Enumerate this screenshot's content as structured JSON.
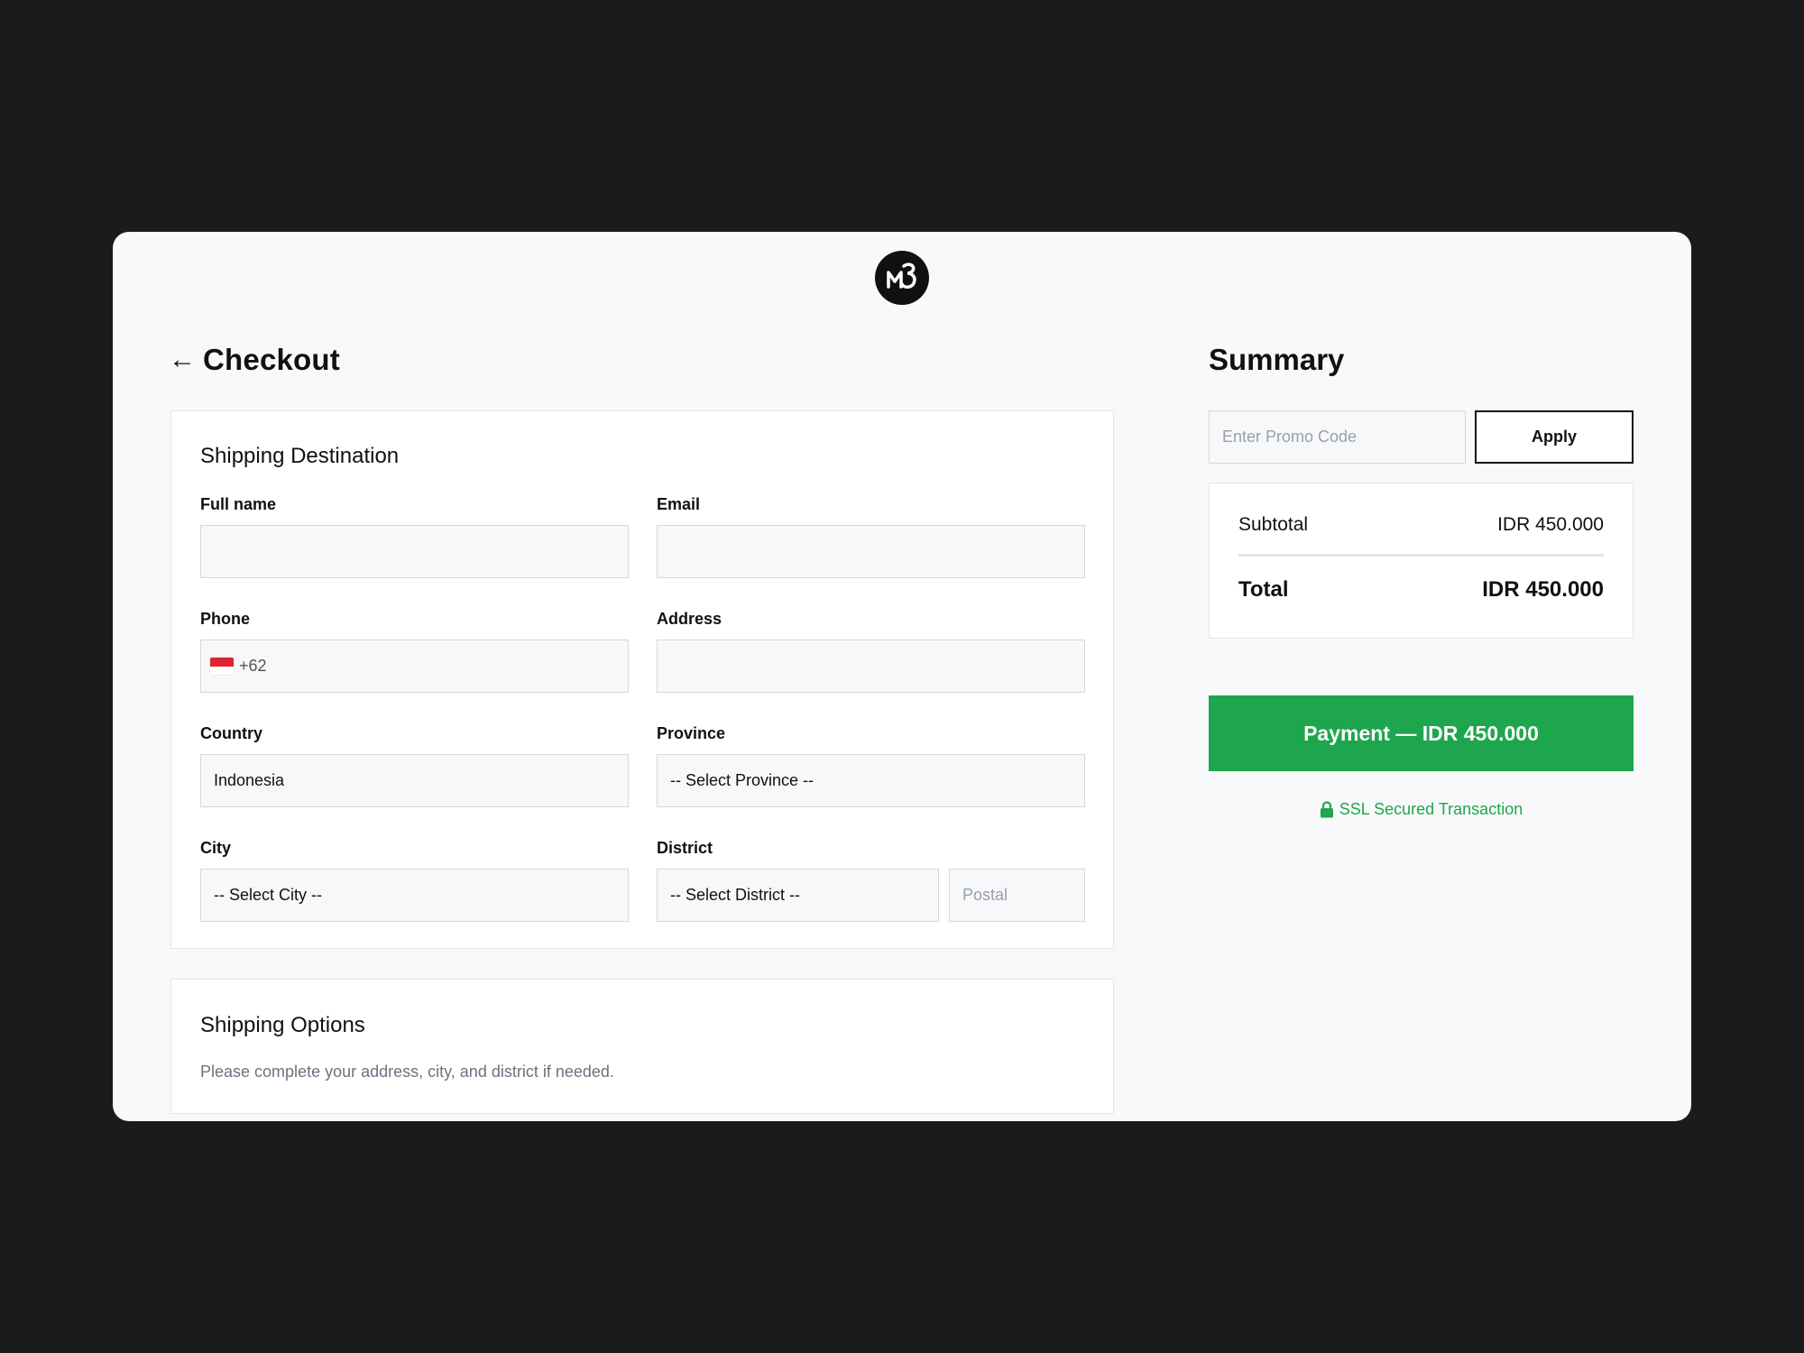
{
  "brand": {
    "logo_icon": "m3-brand-logo"
  },
  "page": {
    "title": "Checkout",
    "back_icon": "arrow-left-icon"
  },
  "shipping_destination": {
    "title": "Shipping Destination",
    "full_name": {
      "label": "Full name",
      "value": ""
    },
    "email": {
      "label": "Email",
      "value": ""
    },
    "phone": {
      "label": "Phone",
      "country_code": "+62",
      "flag_icon": "indonesia-flag-icon",
      "value": ""
    },
    "address": {
      "label": "Address",
      "value": ""
    },
    "country": {
      "label": "Country",
      "value": "Indonesia"
    },
    "province": {
      "label": "Province",
      "value": "-- Select Province --"
    },
    "city": {
      "label": "City",
      "value": "-- Select City --"
    },
    "district": {
      "label": "District",
      "value": "-- Select District --"
    },
    "postal": {
      "placeholder": "Postal",
      "value": ""
    }
  },
  "shipping_options": {
    "title": "Shipping Options",
    "hint": "Please complete your address, city, and district if needed."
  },
  "summary": {
    "title": "Summary",
    "promo_placeholder": "Enter Promo Code",
    "apply_label": "Apply",
    "subtotal_label": "Subtotal",
    "subtotal_value": "IDR 450.000",
    "total_label": "Total",
    "total_value": "IDR 450.000",
    "payment_label": "Payment — IDR 450.000",
    "ssl_label": "SSL Secured Transaction",
    "ssl_icon": "lock-icon"
  },
  "colors": {
    "accent_green": "#1ea64e",
    "background": "#1b1b1b",
    "panel": "#f8f9fb"
  }
}
